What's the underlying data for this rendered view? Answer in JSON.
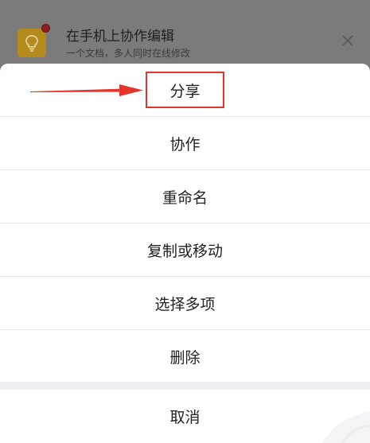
{
  "notification": {
    "title": "在手机上协作编辑",
    "subtitle": "一个文档，多人同时在线修改",
    "icon": "lightbulb-icon",
    "badge_color": "#8a1f1f",
    "close_icon": "close-icon"
  },
  "action_sheet": {
    "items": [
      {
        "label": "分享",
        "highlighted": true
      },
      {
        "label": "协作"
      },
      {
        "label": "重命名"
      },
      {
        "label": "复制或移动"
      },
      {
        "label": "选择多项"
      },
      {
        "label": "删除"
      }
    ],
    "cancel_label": "取消"
  },
  "annotation": {
    "color": "#e3352b",
    "arrow_icon": "arrow-right-icon"
  }
}
